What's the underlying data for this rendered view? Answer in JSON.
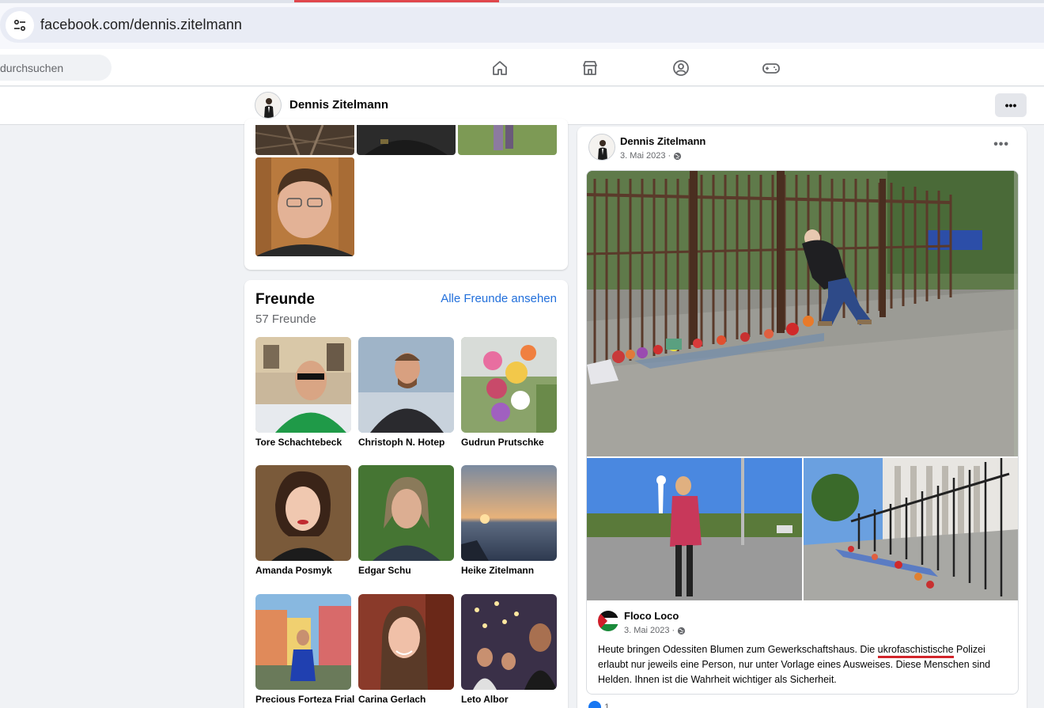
{
  "browser": {
    "url": "facebook.com/dennis.zitelmann"
  },
  "nav": {
    "search_placeholder": "durchsuchen",
    "icons": [
      "home-icon",
      "marketplace-icon",
      "groups-icon",
      "gaming-icon"
    ]
  },
  "profile": {
    "name": "Dennis Zitelmann",
    "more_label": "•••"
  },
  "friends": {
    "title": "Freunde",
    "count": "57 Freunde",
    "see_all": "Alle Freunde ansehen",
    "list": [
      {
        "name": "Tore Schachtebeck"
      },
      {
        "name": "Christoph N. Hotep"
      },
      {
        "name": "Gudrun Prutschke"
      },
      {
        "name": "Amanda Posmyk"
      },
      {
        "name": "Edgar Schu"
      },
      {
        "name": "Heike Zitelmann"
      },
      {
        "name": "Precious Forteza Frial"
      },
      {
        "name": "Carina Gerlach"
      },
      {
        "name": "Leto Albor"
      }
    ]
  },
  "post": {
    "author": "Dennis Zitelmann",
    "date": "3. Mai 2023 ·",
    "more_label": "•••",
    "shared": {
      "author": "Floco Loco",
      "date": "3. Mai 2023 ·",
      "text_before": "Heute bringen Odessiten Blumen zum Gewerkschaftshaus. Die ",
      "text_highlight": "ukrofaschistische",
      "text_after": " Polizei erlaubt nur jeweils eine Person, nur unter Vorlage eines Ausweises. Diese Menschen sind Helden. Ihnen ist die Wahrheit wichtiger als Sicherheit."
    },
    "reaction_count": "1"
  },
  "colors": {
    "accent_link": "#216fdb",
    "underline_red": "#d2232a",
    "tab_red": "#e0474c"
  }
}
